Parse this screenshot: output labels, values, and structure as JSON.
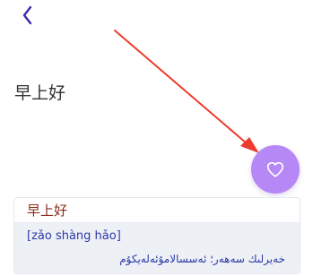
{
  "header": {
    "back_icon": "chevron-left-icon",
    "accent_color": "#3b2bb0"
  },
  "main": {
    "headline": "早上好"
  },
  "favorite": {
    "icon": "heart-outline-icon",
    "bg_color": "#b588f6"
  },
  "annotation": {
    "type": "red-arrow",
    "color": "#ef3b2d"
  },
  "card": {
    "chinese": "早上好",
    "pinyin": "[zǎo shàng hǎo]",
    "translation": "خەيرلىك سەھەر؛ ئەسسالامۇئەلەيكۇم"
  }
}
